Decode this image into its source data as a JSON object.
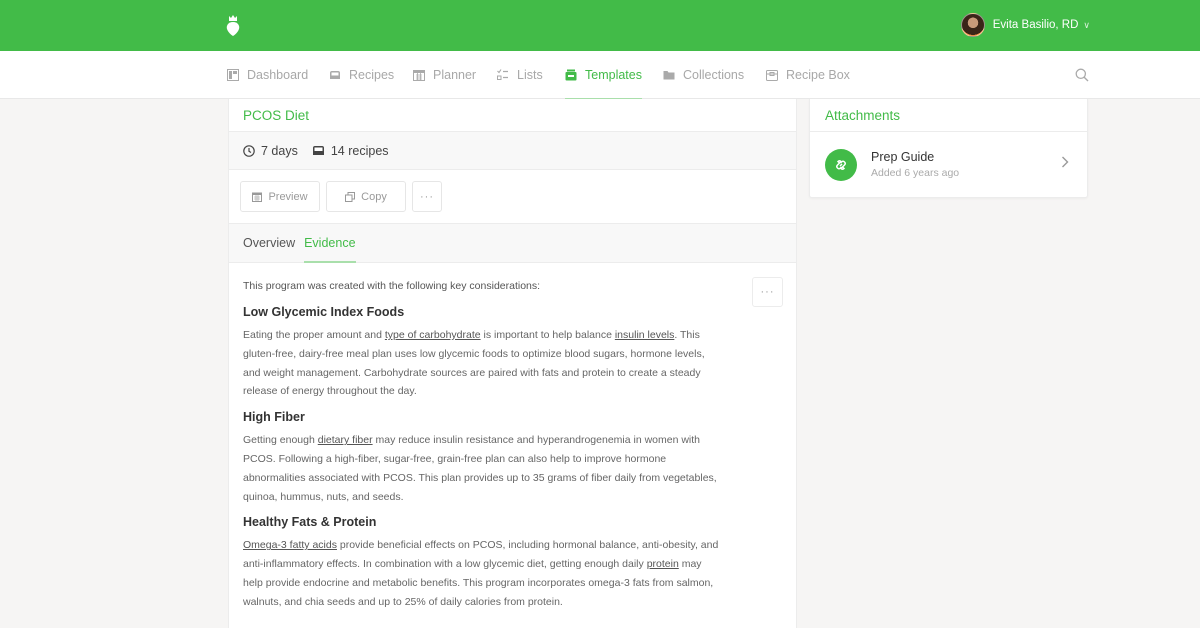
{
  "header": {
    "user_name": "Evita Basilio, RD",
    "brand_color": "#42bb48"
  },
  "nav": {
    "items": [
      {
        "label": "Dashboard",
        "icon": "dashboard-icon"
      },
      {
        "label": "Recipes",
        "icon": "inbox-icon"
      },
      {
        "label": "Planner",
        "icon": "calendar-icon"
      },
      {
        "label": "Lists",
        "icon": "checklist-icon"
      },
      {
        "label": "Templates",
        "icon": "template-icon",
        "active": true
      },
      {
        "label": "Collections",
        "icon": "folder-icon"
      },
      {
        "label": "Recipe Box",
        "icon": "recipe-box-icon"
      }
    ]
  },
  "plan": {
    "title": "PCOS Diet",
    "duration": "7 days",
    "recipes": "14 recipes",
    "actions": {
      "preview": "Preview",
      "copy": "Copy",
      "more": "···"
    },
    "tabs": [
      {
        "label": "Overview"
      },
      {
        "label": "Evidence",
        "active": true
      }
    ]
  },
  "evidence": {
    "intro": "This program was created with the following key considerations:",
    "more": "···",
    "sections": [
      {
        "title": "Low Glycemic Index Foods",
        "parts": [
          {
            "t": "Eating the proper amount and "
          },
          {
            "t": "type of carbohydrate",
            "link": true
          },
          {
            "t": " is important to help balance "
          },
          {
            "t": "insulin levels",
            "link": true
          },
          {
            "t": ". This gluten-free, dairy-free meal plan uses low glycemic foods to optimize blood sugars, hormone levels, and weight management. Carbohydrate sources are paired with fats and protein to create a steady release of energy throughout the day."
          }
        ]
      },
      {
        "title": "High Fiber",
        "parts": [
          {
            "t": "Getting enough "
          },
          {
            "t": "dietary fiber",
            "link": true
          },
          {
            "t": " may reduce insulin resistance and hyperandrogenemia in women with PCOS. Following a high-fiber, sugar-free, grain-free plan can also help to improve hormone abnormalities associated with PCOS. This plan provides up to 35 grams of fiber daily from vegetables, quinoa, hummus, nuts, and seeds."
          }
        ]
      },
      {
        "title": "Healthy Fats & Protein",
        "parts": [
          {
            "t": "Omega-3 fatty acids",
            "link": true
          },
          {
            "t": " provide beneficial effects on PCOS, including hormonal balance, anti-obesity, and anti-inflammatory effects. In combination with a low glycemic diet, getting enough daily "
          },
          {
            "t": "protein",
            "link": true
          },
          {
            "t": " may help provide endocrine and metabolic benefits. This program incorporates omega-3 fats from salmon, walnuts, and chia seeds and up to 25% of daily calories from protein."
          }
        ]
      }
    ]
  },
  "attachments": {
    "title": "Attachments",
    "items": [
      {
        "name": "Prep Guide",
        "added": "Added 6 years ago",
        "icon": "link-icon"
      }
    ]
  }
}
